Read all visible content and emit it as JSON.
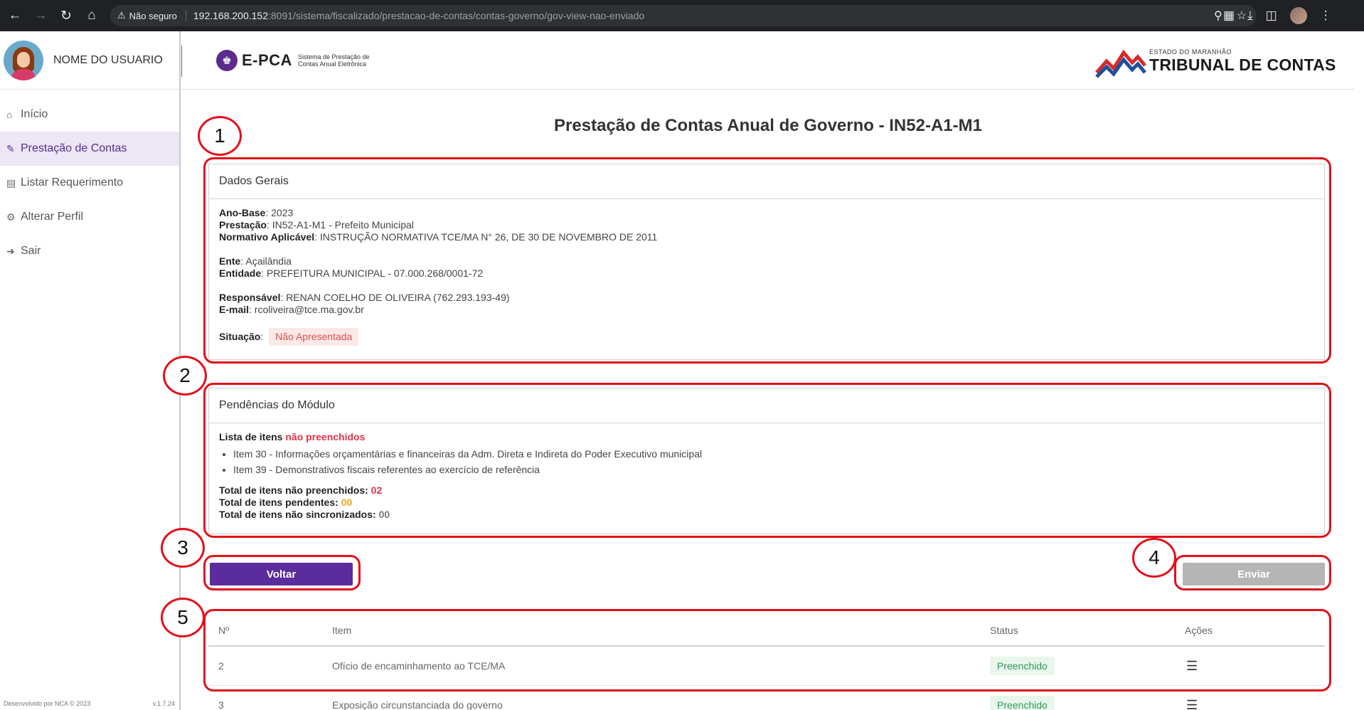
{
  "browser": {
    "security": "Não seguro",
    "url_host": "192.168.200.152",
    "url_path": ":8091/sistema/fiscalizado/prestacao-de-contas/contas-governo/gov-view-nao-enviado"
  },
  "sidebar": {
    "user_name": "NOME DO USUARIO",
    "items": [
      {
        "label": "Início",
        "icon": "home-icon"
      },
      {
        "label": "Prestação de Contas",
        "icon": "user-edit-icon",
        "active": true
      },
      {
        "label": "Listar Requerimento",
        "icon": "document-icon"
      },
      {
        "label": "Alterar Perfil",
        "icon": "user-gear-icon"
      },
      {
        "label": "Sair",
        "icon": "logout-icon"
      }
    ],
    "footer_left": "Desenvolvido por NCA © 2023",
    "footer_right": "v.1.7.24"
  },
  "header": {
    "app_name": "E-PCA",
    "app_sub_1": "Sistema de Prestação de",
    "app_sub_2": "Contas Anual Eletrônica",
    "org_small": "ESTADO DO MARANHÃO",
    "org_big": "TRIBUNAL DE CONTAS"
  },
  "page_title": "Prestação de Contas Anual de Governo - IN52-A1-M1",
  "dados_gerais": {
    "title": "Dados Gerais",
    "ano_base_label": "Ano-Base",
    "ano_base": "2023",
    "prestacao_label": "Prestação",
    "prestacao": "IN52-A1-M1 - Prefeito Municipal",
    "normativo_label": "Normativo Aplicável",
    "normativo": "INSTRUÇÃO NORMATIVA TCE/MA N° 26, DE 30 DE NOVEMBRO DE 2011",
    "ente_label": "Ente",
    "ente": "Açailândia",
    "entidade_label": "Entidade",
    "entidade": "PREFEITURA MUNICIPAL - 07.000.268/0001-72",
    "responsavel_label": "Responsável",
    "responsavel": "RENAN COELHO DE OLIVEIRA (762.293.193-49)",
    "email_label": "E-mail",
    "email": "rcoliveira@tce.ma.gov.br",
    "situacao_label": "Situação",
    "situacao": "Não Apresentada"
  },
  "pendencias": {
    "title": "Pendências do Módulo",
    "lista_label": "Lista de itens",
    "lista_highlight": "não preenchidos",
    "items": [
      "Item 30 - Informações orçamentárias e financeiras da Adm. Direta e Indireta do Poder Executivo municipal",
      "Item 39 - Demonstrativos fiscais referentes ao exercício de referência"
    ],
    "total_nao_preenchidos_label": "Total de itens não preenchidos:",
    "total_nao_preenchidos": "02",
    "total_pendentes_label": "Total de itens pendentes:",
    "total_pendentes": "00",
    "total_nao_sincronizados_label": "Total de itens não sincronizados:",
    "total_nao_sincronizados": "00"
  },
  "buttons": {
    "voltar": "Voltar",
    "enviar": "Enviar"
  },
  "table": {
    "headers": [
      "Nº",
      "Item",
      "Status",
      "Ações"
    ],
    "rows": [
      {
        "no": "2",
        "item": "Ofício de encaminhamento ao TCE/MA",
        "status": "Preenchido"
      },
      {
        "no": "3",
        "item": "Exposição circunstanciada do governo",
        "status": "Preenchido"
      }
    ]
  },
  "annotations": [
    "1",
    "2",
    "3",
    "4",
    "5"
  ],
  "colors": {
    "accent": "#5b2c9c",
    "annotation": "#e2101a",
    "danger": "#e0334a",
    "warning": "#f0a81c",
    "success": "#2e9b55"
  }
}
